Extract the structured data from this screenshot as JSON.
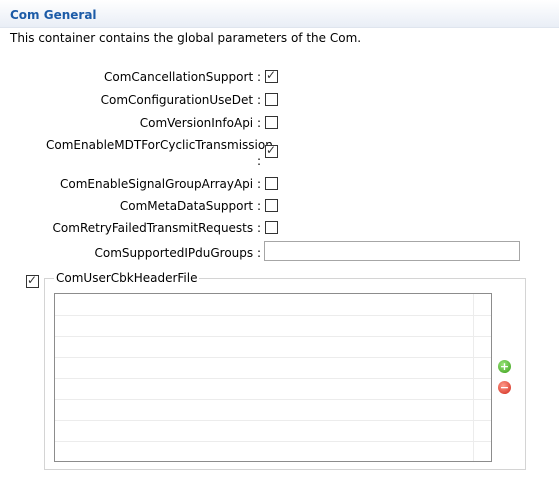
{
  "header": {
    "title": "Com General",
    "description": "This container contains the global parameters of the Com."
  },
  "fields": [
    {
      "label": "ComCancellationSupport :",
      "checked": true
    },
    {
      "label": "ComConfigurationUseDet :",
      "checked": false
    },
    {
      "label": "ComVersionInfoApi :",
      "checked": false
    },
    {
      "label": "ComEnableMDTForCyclicTransmission :",
      "checked": true
    },
    {
      "label": "ComEnableSignalGroupArrayApi :",
      "checked": false
    },
    {
      "label": "ComMetaDataSupport :",
      "checked": false
    },
    {
      "label": "ComRetryFailedTransmitRequests :",
      "checked": false
    }
  ],
  "supported_groups": {
    "label": "ComSupportedIPduGroups :",
    "value": ""
  },
  "header_file": {
    "label": "ComUserCbkHeaderFile",
    "checked": true,
    "rows": [
      "",
      "",
      "",
      "",
      "",
      "",
      "",
      ""
    ]
  },
  "buttons": {
    "add": "+",
    "remove": "−"
  },
  "icons": {
    "check": "✓"
  }
}
